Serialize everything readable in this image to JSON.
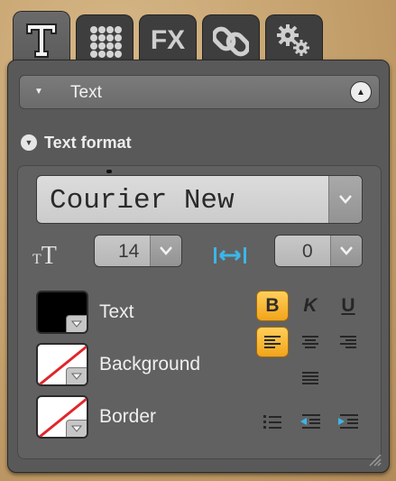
{
  "tabs": [
    {
      "name": "text-icon",
      "active": true
    },
    {
      "name": "grid-icon",
      "active": false
    },
    {
      "name": "fx-icon",
      "active": false,
      "label": "FX"
    },
    {
      "name": "link-icon",
      "active": false
    },
    {
      "name": "gears-icon",
      "active": false
    }
  ],
  "section": {
    "title": "Text"
  },
  "text_format": {
    "heading": "Text format",
    "font": {
      "value": "Courier New"
    },
    "font_size": {
      "value": "14"
    },
    "letter_spacing": {
      "value": "0"
    },
    "colors": {
      "text": {
        "label": "Text",
        "color": "#000000"
      },
      "background": {
        "label": "Background",
        "color": "none"
      },
      "border": {
        "label": "Border",
        "color": "none"
      }
    },
    "style_buttons": {
      "bold": "B",
      "italic": "K",
      "underline": "U"
    },
    "active_states": {
      "bold": true,
      "align_left": true
    },
    "accent_color": "#f5b323"
  }
}
